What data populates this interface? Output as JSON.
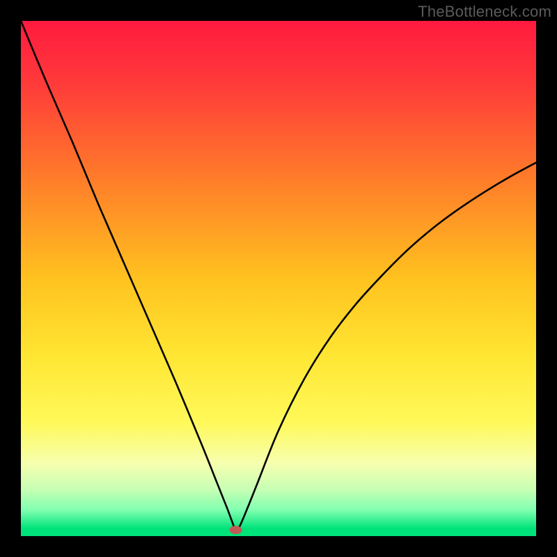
{
  "watermark": "TheBottleneck.com",
  "chart_data": {
    "type": "line",
    "title": "",
    "xlabel": "",
    "ylabel": "",
    "xlim": [
      0,
      100
    ],
    "ylim": [
      0,
      100
    ],
    "background_gradient": {
      "stops": [
        {
          "offset": 0.0,
          "color": "#ff1a3f"
        },
        {
          "offset": 0.12,
          "color": "#ff3a3a"
        },
        {
          "offset": 0.3,
          "color": "#ff7a2a"
        },
        {
          "offset": 0.5,
          "color": "#ffc21f"
        },
        {
          "offset": 0.65,
          "color": "#ffe633"
        },
        {
          "offset": 0.78,
          "color": "#fff95a"
        },
        {
          "offset": 0.86,
          "color": "#f6ffb0"
        },
        {
          "offset": 0.91,
          "color": "#c6ffb4"
        },
        {
          "offset": 0.95,
          "color": "#7fffb0"
        },
        {
          "offset": 0.985,
          "color": "#00e37a"
        },
        {
          "offset": 1.0,
          "color": "#00e37a"
        }
      ]
    },
    "series": [
      {
        "name": "bottleneck-curve",
        "color": "#000000",
        "stroke_width": 2.6,
        "x": [
          0,
          5,
          10,
          15,
          20,
          25,
          30,
          35,
          38,
          40,
          41,
          41.7,
          42.5,
          44,
          46,
          50,
          55,
          60,
          65,
          70,
          75,
          80,
          85,
          90,
          95,
          100
        ],
        "values": [
          100,
          88,
          76.5,
          64.5,
          53,
          41.5,
          30,
          18,
          10.5,
          5.5,
          2.8,
          1.2,
          2.0,
          5.5,
          10.5,
          20.5,
          30.5,
          38.5,
          45.0,
          50.5,
          55.5,
          59.8,
          63.5,
          66.8,
          69.8,
          72.5
        ]
      }
    ],
    "marker": {
      "name": "optimal-point",
      "x": 41.7,
      "y": 1.2,
      "color": "#c15a57",
      "rx": 9,
      "ry": 6
    }
  }
}
